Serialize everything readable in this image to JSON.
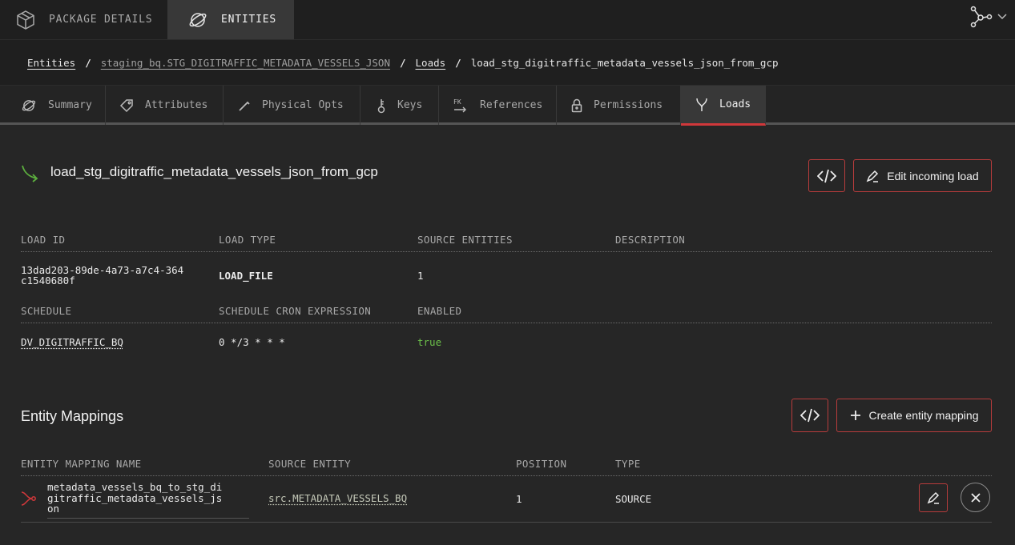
{
  "top_tabs": [
    {
      "label": "PACKAGE DETAILS",
      "icon": "package-icon"
    },
    {
      "label": "ENTITIES",
      "icon": "entity-icon"
    }
  ],
  "breadcrumb": {
    "items": [
      "Entities",
      "staging_bq.STG_DIGITRAFFIC_METADATA_VESSELS_JSON",
      "Loads"
    ],
    "current": "load_stg_digitraffic_metadata_vessels_json_from_gcp",
    "separator": "/"
  },
  "tabs": [
    {
      "label": "Summary",
      "icon": "entity-icon"
    },
    {
      "label": "Attributes",
      "icon": "tag-icon"
    },
    {
      "label": "Physical Opts",
      "icon": "wrench-icon"
    },
    {
      "label": "Keys",
      "icon": "key-icon"
    },
    {
      "label": "References",
      "icon": "fk-icon"
    },
    {
      "label": "Permissions",
      "icon": "lock-icon"
    },
    {
      "label": "Loads",
      "icon": "load-icon"
    }
  ],
  "active_tab": "Loads",
  "load": {
    "title": "load_stg_digitraffic_metadata_vessels_json_from_gcp",
    "edit_label": "Edit incoming load",
    "fields_row1": {
      "load_id_label": "LOAD ID",
      "load_id_value_1": "13dad203-89de-4a73-a7c4-364",
      "load_id_value_2": "c1540680f",
      "load_type_label": "LOAD TYPE",
      "load_type_value": "LOAD_FILE",
      "source_entities_label": "SOURCE ENTITIES",
      "source_entities_value": "1",
      "description_label": "DESCRIPTION"
    },
    "fields_row2": {
      "schedule_label": "SCHEDULE",
      "schedule_value": "DV_DIGITRAFFIC_BQ",
      "cron_label": "SCHEDULE CRON EXPRESSION",
      "cron_value": "0 */3 * * *",
      "enabled_label": "ENABLED",
      "enabled_value": "true"
    }
  },
  "mappings": {
    "title": "Entity Mappings",
    "create_label": "Create entity mapping",
    "columns": [
      "ENTITY MAPPING NAME",
      "SOURCE ENTITY",
      "POSITION",
      "TYPE"
    ],
    "rows": [
      {
        "name_1": "metadata_vessels_bq_to_stg_di",
        "name_2": "gitraffic_metadata_vessels_js",
        "name_3": "on",
        "source_entity": "src.METADATA_VESSELS_BQ",
        "position": "1",
        "type": "SOURCE"
      }
    ]
  },
  "colors": {
    "accent": "#d0383b",
    "enabled_true": "#6cc04a",
    "background": "#262626"
  }
}
